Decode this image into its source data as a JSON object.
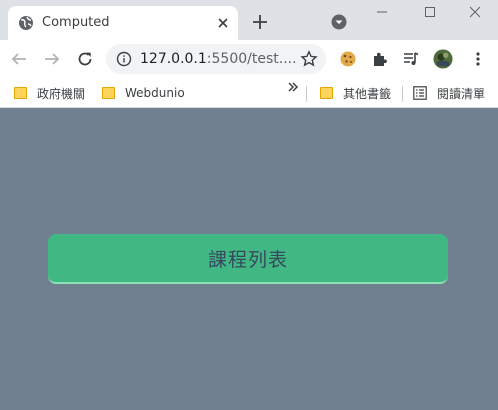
{
  "browser": {
    "tab_title": "Computed",
    "url_host": "127.0.0.1",
    "url_rest": ":5500/test....",
    "bookmarks": [
      {
        "label": "政府機關"
      },
      {
        "label": "Webdunio"
      }
    ],
    "other_bookmarks": "其他書籤",
    "reading_list": "閱讀清單",
    "icons": {
      "tab": "globe-icon",
      "close": "close-icon",
      "new_tab": "plus-icon",
      "tab_search": "chevron-down-circle-icon",
      "back": "back-arrow-icon",
      "forward": "forward-arrow-icon",
      "reload": "reload-icon",
      "site_info": "info-icon",
      "bookmark": "star-icon",
      "cookie_ext": "cookie-icon",
      "extensions": "puzzle-icon",
      "media": "media-queue-icon",
      "profile": "avatar",
      "menu": "kebab-menu-icon",
      "more_bookmarks": "double-chevron-icon",
      "reading_list": "reading-list-icon"
    }
  },
  "page": {
    "background_color": "#708090",
    "button_label": "課程列表",
    "button_color": "#41b883",
    "button_text_color": "#35495e"
  }
}
